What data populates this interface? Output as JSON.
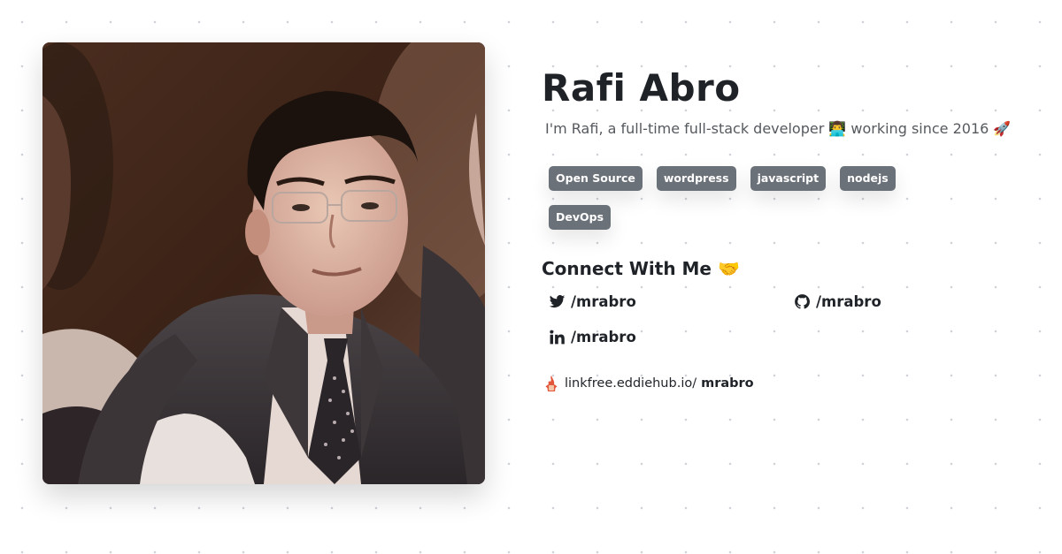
{
  "profile": {
    "name": "Rafi Abro",
    "bio": "I'm Rafi, a full-time full-stack developer 👨‍💻 working since 2016 🚀",
    "photo_alt": "profile-photo"
  },
  "tags": [
    "Open Source",
    "wordpress",
    "javascript",
    "nodejs",
    "DevOps"
  ],
  "connect": {
    "title": "Connect With Me 🤝",
    "links": [
      {
        "icon": "twitter-icon",
        "label": "/mrabro"
      },
      {
        "icon": "github-icon",
        "label": "/mrabro"
      },
      {
        "icon": "linkedin-icon",
        "label": "/mrabro"
      }
    ]
  },
  "footer": {
    "icon": "linkfree-logo-icon",
    "domain": "linkfree.eddiehub.io/",
    "username": "mrabro"
  },
  "colors": {
    "tag_bg": "#6b7178",
    "text": "#1f2328",
    "muted": "#55595e"
  }
}
